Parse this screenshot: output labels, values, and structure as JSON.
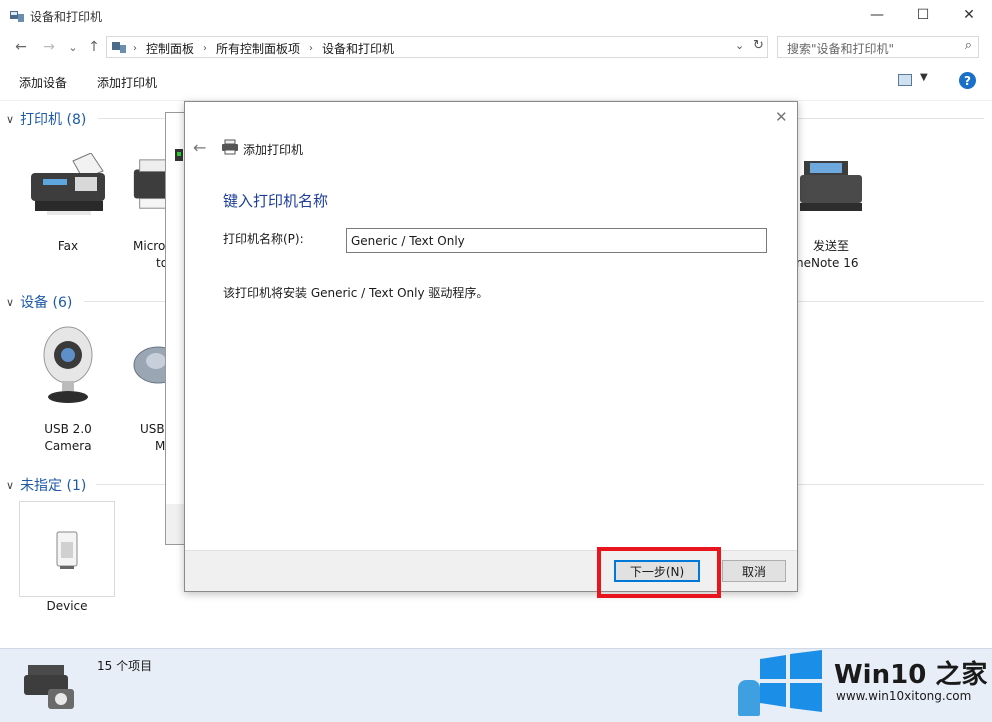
{
  "window": {
    "title": "设备和打印机",
    "controls": {
      "minimize": "—",
      "maximize": "☐",
      "close": "✕"
    }
  },
  "navigation": {
    "back": "←",
    "forward": "→",
    "recent": "⌄",
    "up": "↑",
    "breadcrumbs": [
      "控制面板",
      "所有控制面板项",
      "设备和打印机"
    ],
    "search_placeholder": "搜索\"设备和打印机\""
  },
  "commandbar": {
    "add_device": "添加设备",
    "add_printer": "添加打印机"
  },
  "groups": {
    "printers": {
      "label": "打印机 (8)",
      "items": [
        {
          "name": "Fax"
        },
        {
          "name": "Micro",
          "name2": "to"
        },
        {
          "name": "发送至",
          "name2": "neNote 16"
        }
      ]
    },
    "devices": {
      "label": "设备 (6)",
      "items": [
        {
          "name": "USB 2.0",
          "name2": "Camera"
        },
        {
          "name": "USB",
          "name2": "M"
        }
      ]
    },
    "unspecified": {
      "label": "未指定 (1)",
      "items": [
        {
          "name": "Device"
        }
      ]
    }
  },
  "status": {
    "count_text": "15 个项目"
  },
  "dialog": {
    "title": "添加打印机",
    "heading": "键入打印机名称",
    "field_label": "打印机名称(P):",
    "printer_name_value": "Generic / Text Only",
    "info": "该打印机将安装 Generic / Text Only 驱动程序。",
    "next_button": "下一步(N)",
    "cancel_button": "取消"
  },
  "watermark": {
    "brand": "Win10 之家",
    "url": "www.win10xitong.com"
  },
  "colors": {
    "group_header": "#1e5aa8",
    "heading": "#1f3e99",
    "highlight": "#e8141e",
    "statusbar": "#e8eef7"
  }
}
